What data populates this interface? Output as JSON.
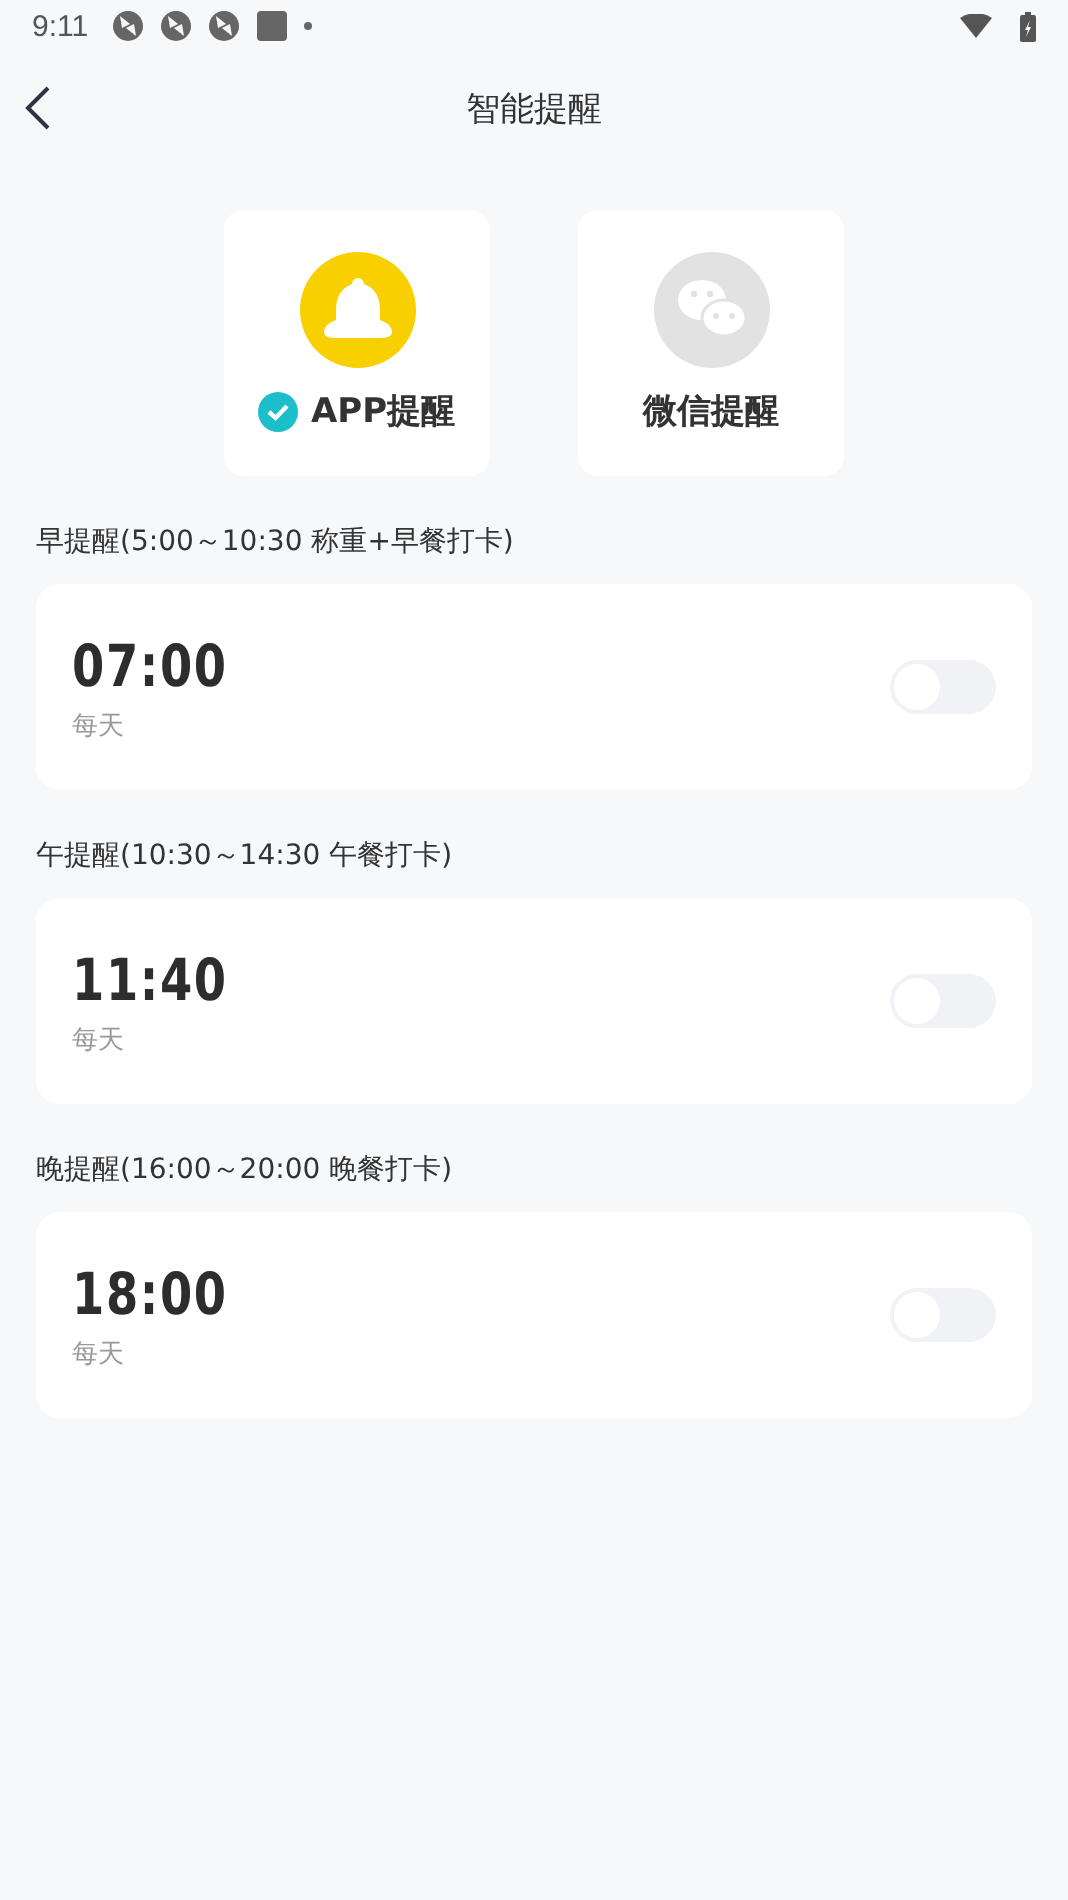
{
  "status_bar": {
    "time": "9:11"
  },
  "header": {
    "title": "智能提醒"
  },
  "channels": [
    {
      "kind": "app",
      "label": "APP提醒",
      "selected": true
    },
    {
      "kind": "wechat",
      "label": "微信提醒",
      "selected": false
    }
  ],
  "reminders": [
    {
      "heading": "早提醒(5:00～10:30 称重+早餐打卡)",
      "time": "07:00",
      "repeat": "每天",
      "on": false
    },
    {
      "heading": "午提醒(10:30～14:30 午餐打卡)",
      "time": "11:40",
      "repeat": "每天",
      "on": false
    },
    {
      "heading": "晚提醒(16:00～20:00 晚餐打卡)",
      "time": "18:00",
      "repeat": "每天",
      "on": false
    }
  ]
}
